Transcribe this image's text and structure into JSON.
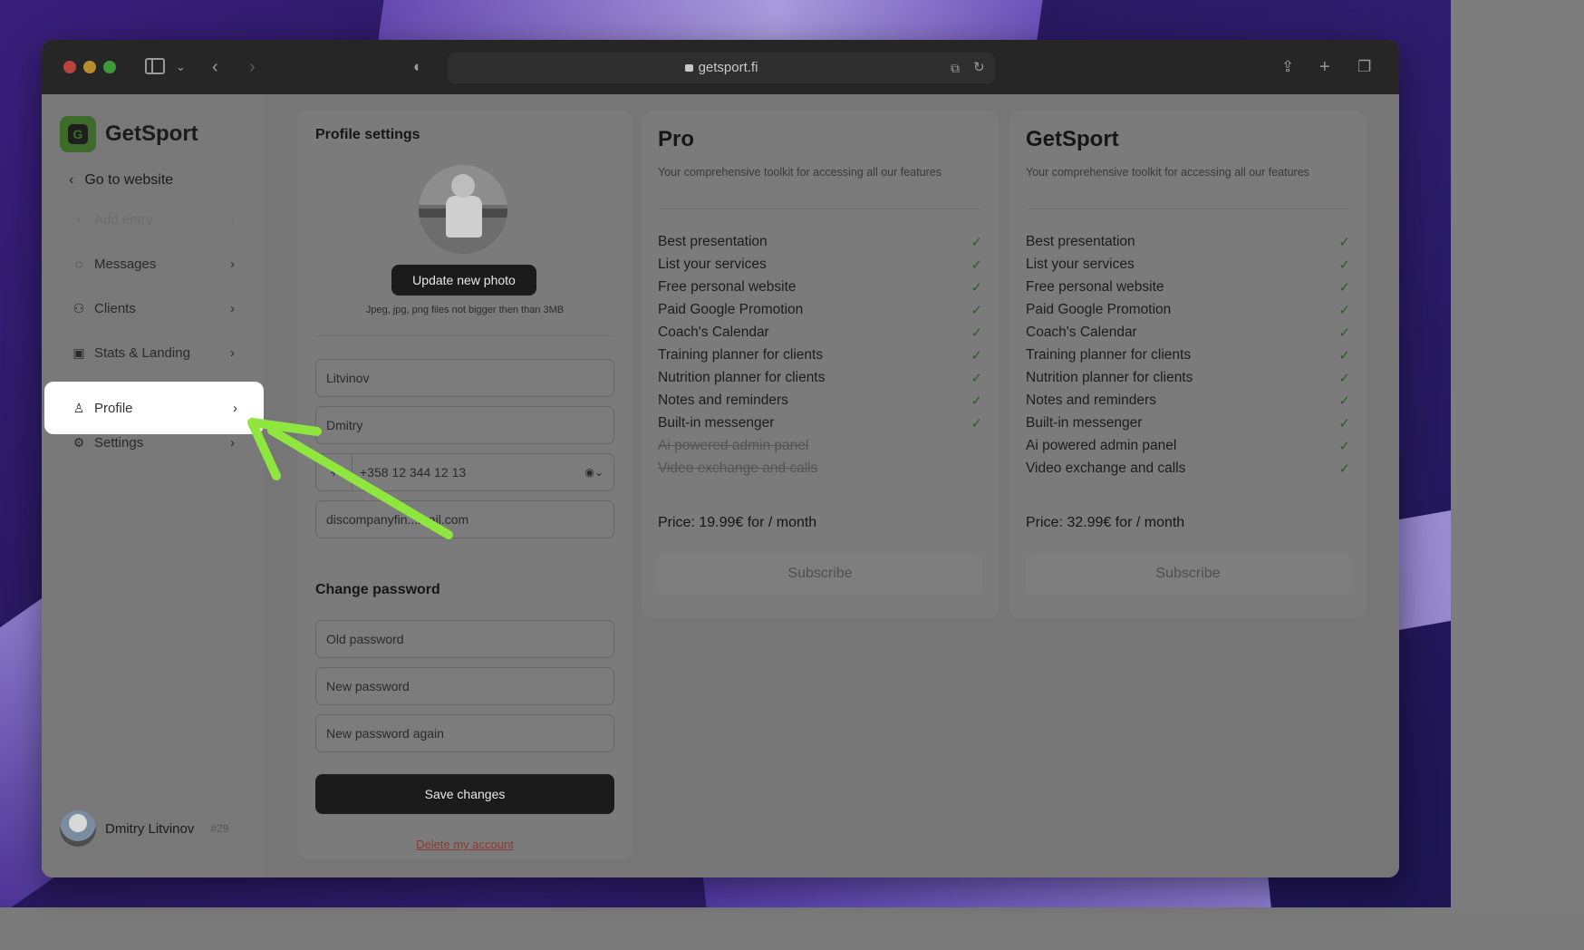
{
  "browser": {
    "url": "getsport.fi"
  },
  "sidebar": {
    "brand": "GetSport",
    "go_to_website": "Go to website",
    "items": [
      {
        "label": "Add entry",
        "icon": "plus-icon"
      },
      {
        "label": "Messages",
        "icon": "chat-icon"
      },
      {
        "label": "Clients",
        "icon": "users-icon"
      },
      {
        "label": "Stats & Landing",
        "icon": "stats-icon"
      },
      {
        "label": "Profile",
        "icon": "user-icon"
      },
      {
        "label": "Settings",
        "icon": "gear-icon"
      }
    ],
    "user": {
      "name": "Dmitry Litvinov",
      "id": "#29"
    }
  },
  "profile": {
    "title": "Profile settings",
    "update_photo": "Update new photo",
    "photo_hint": "Jpeg, jpg, png files not bigger then than 3MB",
    "last_name": "Litvinov",
    "first_name": "Dmitry",
    "phone": "+358 12 344 12 13",
    "email": "discompanyfin...mail.com",
    "change_password_title": "Change password",
    "old_password_placeholder": "Old password",
    "new_password_placeholder": "New password",
    "new_password_again_placeholder": "New password again",
    "save": "Save changes",
    "delete": "Delete my account"
  },
  "plans": [
    {
      "name": "Pro",
      "description": "Your comprehensive toolkit for accessing all our features",
      "features": [
        {
          "label": "Best presentation",
          "included": true
        },
        {
          "label": "List your services",
          "included": true
        },
        {
          "label": "Free personal website",
          "included": true
        },
        {
          "label": "Paid Google Promotion",
          "included": true
        },
        {
          "label": "Coach's Calendar",
          "included": true
        },
        {
          "label": "Training planner for clients",
          "included": true
        },
        {
          "label": "Nutrition planner for clients",
          "included": true
        },
        {
          "label": "Notes and reminders",
          "included": true
        },
        {
          "label": "Built-in messenger",
          "included": true
        },
        {
          "label": "Ai powered admin panel",
          "included": false
        },
        {
          "label": "Video exchange and calls",
          "included": false
        }
      ],
      "price": "Price: 19.99€ for / month",
      "subscribe": "Subscribe"
    },
    {
      "name": "GetSport",
      "description": "Your comprehensive toolkit for accessing all our features",
      "features": [
        {
          "label": "Best presentation",
          "included": true
        },
        {
          "label": "List your services",
          "included": true
        },
        {
          "label": "Free personal website",
          "included": true
        },
        {
          "label": "Paid Google Promotion",
          "included": true
        },
        {
          "label": "Coach's Calendar",
          "included": true
        },
        {
          "label": "Training planner for clients",
          "included": true
        },
        {
          "label": "Nutrition planner for clients",
          "included": true
        },
        {
          "label": "Notes and reminders",
          "included": true
        },
        {
          "label": "Built-in messenger",
          "included": true
        },
        {
          "label": "Ai powered admin panel",
          "included": true
        },
        {
          "label": "Video exchange and calls",
          "included": true
        }
      ],
      "price": "Price: 32.99€ for / month",
      "subscribe": "Subscribe"
    }
  ],
  "colors": {
    "highlight_arrow": "#8ee63f",
    "brand_green": "#3d6b2a"
  }
}
